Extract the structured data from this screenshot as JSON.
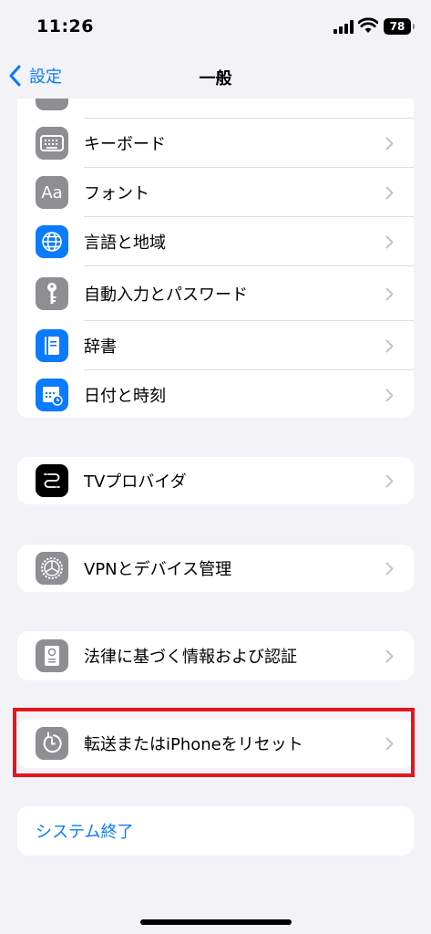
{
  "status": {
    "time": "11:26",
    "battery": "78"
  },
  "nav": {
    "back_label": "設定",
    "title": "一般"
  },
  "group1": {
    "items": [
      {
        "label": "キーボード",
        "icon": "keyboard-icon"
      },
      {
        "label": "フォント",
        "icon": "font-icon",
        "icon_text": "Aa"
      },
      {
        "label": "言語と地域",
        "icon": "globe-icon"
      },
      {
        "label": "自動入力とパスワード",
        "icon": "key-icon"
      },
      {
        "label": "辞書",
        "icon": "dictionary-icon"
      },
      {
        "label": "日付と時刻",
        "icon": "calendar-clock-icon"
      }
    ]
  },
  "group2": {
    "items": [
      {
        "label": "TVプロバイダ",
        "icon": "tv-provider-icon"
      }
    ]
  },
  "group3": {
    "items": [
      {
        "label": "VPNとデバイス管理",
        "icon": "gear-icon"
      }
    ]
  },
  "group4": {
    "items": [
      {
        "label": "法律に基づく情報および認証",
        "icon": "certificate-icon"
      }
    ]
  },
  "group5": {
    "items": [
      {
        "label": "転送またはiPhoneをリセット",
        "icon": "reset-icon"
      }
    ]
  },
  "group6": {
    "items": [
      {
        "label": "システム終了"
      }
    ]
  },
  "colors": {
    "accent": "#0a7aff",
    "highlight": "#e5151c",
    "icon_gray": "#8e8e93"
  }
}
